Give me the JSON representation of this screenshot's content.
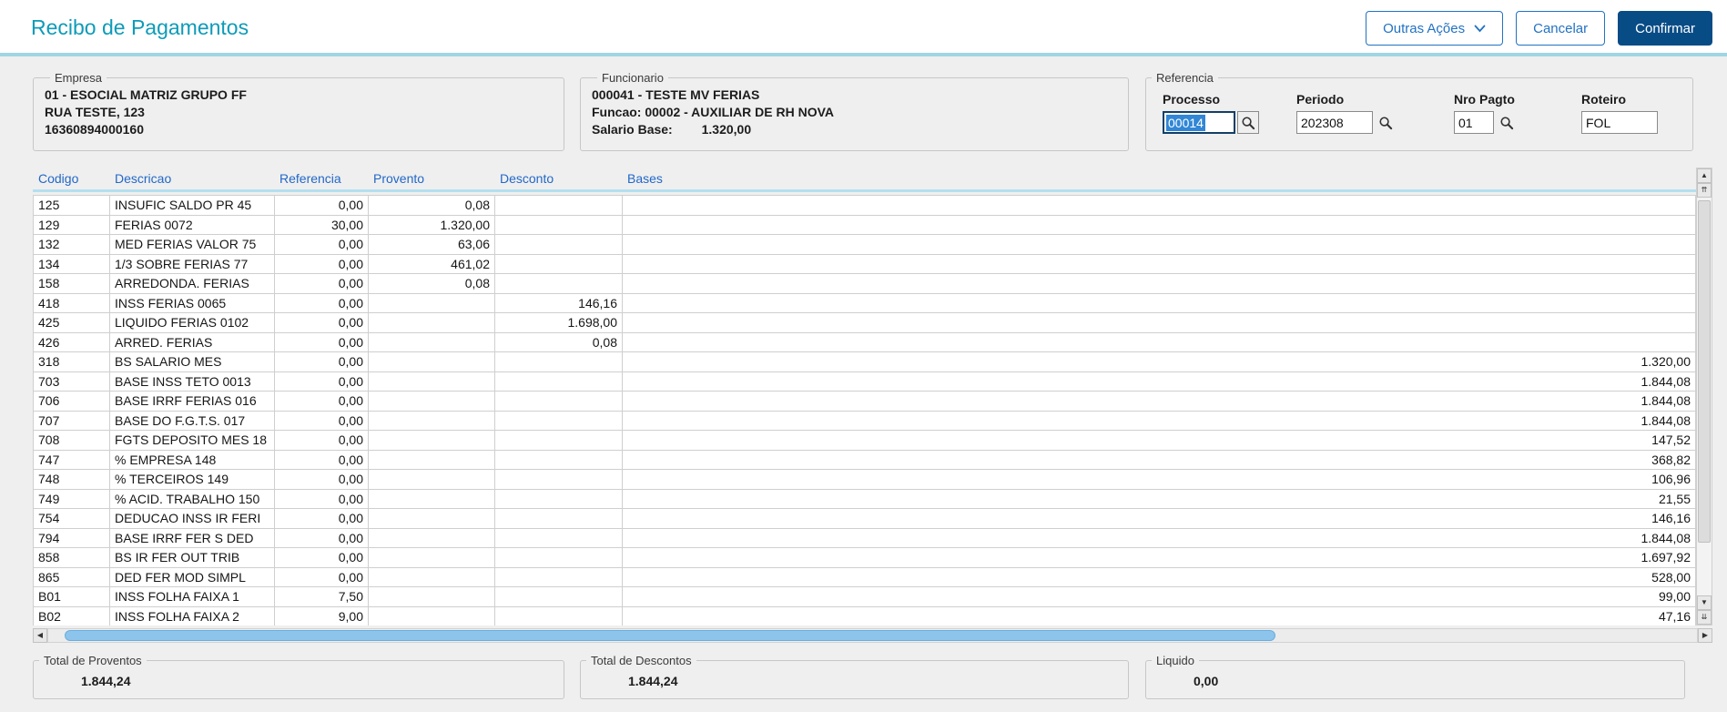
{
  "window": {
    "title": "Recibo de Pagamentos"
  },
  "toolbar": {
    "outras_acoes": "Outras Ações",
    "cancelar": "Cancelar",
    "confirmar": "Confirmar"
  },
  "empresa": {
    "legend": "Empresa",
    "lines": [
      "01 - ESOCIAL MATRIZ GRUPO FF",
      "RUA TESTE, 123",
      "16360894000160"
    ]
  },
  "funcionario": {
    "legend": "Funcionario",
    "line1": "000041 - TESTE MV FERIAS",
    "line2": "Funcao: 00002 - AUXILIAR DE RH NOVA",
    "salario_label": "Salario Base:",
    "salario_value": "1.320,00"
  },
  "referencia": {
    "legend": "Referencia",
    "processo": {
      "label": "Processo",
      "value": "00014"
    },
    "periodo": {
      "label": "Periodo",
      "value": "202308"
    },
    "nro_pagto": {
      "label": "Nro Pagto",
      "value": "01"
    },
    "roteiro": {
      "label": "Roteiro",
      "value": "FOL"
    }
  },
  "grid": {
    "columns": [
      "Codigo",
      "Descricao",
      "Referencia",
      "Provento",
      "Desconto",
      "Bases"
    ],
    "rows": [
      [
        "125",
        "INSUFIC  SALDO PR 45",
        "0,00",
        "0,08",
        "",
        ""
      ],
      [
        "129",
        "FERIAS 0072",
        "30,00",
        "1.320,00",
        "",
        ""
      ],
      [
        "132",
        "MED FERIAS VALOR  75",
        "0,00",
        "63,06",
        "",
        ""
      ],
      [
        "134",
        "1/3 SOBRE FERIAS 77",
        "0,00",
        "461,02",
        "",
        ""
      ],
      [
        "158",
        "ARREDONDA. FERIAS",
        "0,00",
        "0,08",
        "",
        ""
      ],
      [
        "418",
        "INSS FERIAS 0065",
        "0,00",
        "",
        "146,16",
        ""
      ],
      [
        "425",
        "LIQUIDO FERIAS 0102",
        "0,00",
        "",
        "1.698,00",
        ""
      ],
      [
        "426",
        "ARRED. FERIAS",
        "0,00",
        "",
        "0,08",
        ""
      ],
      [
        "318",
        "BS SALARIO MES",
        "0,00",
        "",
        "",
        "1.320,00"
      ],
      [
        "703",
        "BASE INSS TETO 0013",
        "0,00",
        "",
        "",
        "1.844,08"
      ],
      [
        "706",
        "BASE IRRF FERIAS 016",
        "0,00",
        "",
        "",
        "1.844,08"
      ],
      [
        "707",
        "BASE DO F.G.T.S. 017",
        "0,00",
        "",
        "",
        "1.844,08"
      ],
      [
        "708",
        "FGTS DEPOSITO MES 18",
        "0,00",
        "",
        "",
        "147,52"
      ],
      [
        "747",
        "% EMPRESA  148",
        "0,00",
        "",
        "",
        "368,82"
      ],
      [
        "748",
        "% TERCEIROS 149",
        "0,00",
        "",
        "",
        "106,96"
      ],
      [
        "749",
        "% ACID. TRABALHO 150",
        "0,00",
        "",
        "",
        "21,55"
      ],
      [
        "754",
        "DEDUCAO INSS IR FERI",
        "0,00",
        "",
        "",
        "146,16"
      ],
      [
        "794",
        "BASE IRRF FER S DED",
        "0,00",
        "",
        "",
        "1.844,08"
      ],
      [
        "858",
        "BS IR FER OUT TRIB",
        "0,00",
        "",
        "",
        "1.697,92"
      ],
      [
        "865",
        "DED FER MOD SIMPL",
        "0,00",
        "",
        "",
        "528,00"
      ],
      [
        "B01",
        "INSS FOLHA FAIXA 1",
        "7,50",
        "",
        "",
        "99,00"
      ],
      [
        "B02",
        "INSS FOLHA FAIXA 2",
        "9,00",
        "",
        "",
        "47,16"
      ]
    ]
  },
  "totals": {
    "proventos": {
      "legend": "Total de Proventos",
      "value": "1.844,24"
    },
    "descontos": {
      "legend": "Total de Descontos",
      "value": "1.844,24"
    },
    "liquido": {
      "legend": "Liquido",
      "value": "0,00"
    }
  },
  "icons": {
    "up": "▲",
    "page_up": "⇈",
    "down": "▼",
    "page_down": "⇊",
    "left": "◀",
    "right": "▶"
  }
}
